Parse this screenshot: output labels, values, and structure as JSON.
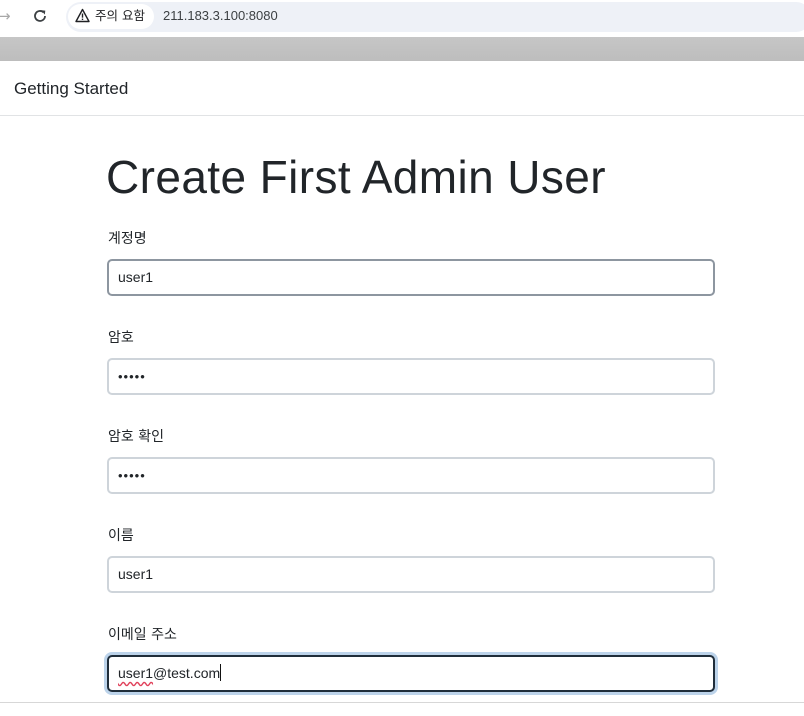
{
  "browser": {
    "forward_icon": "arrow-right-icon",
    "reload_icon": "reload-icon",
    "security_icon": "warning-triangle-icon",
    "security_label": "주의 요함",
    "url": "211.183.3.100:8080"
  },
  "panel": {
    "header_title": "Getting Started",
    "page_title": "Create First Admin User"
  },
  "form": {
    "username": {
      "label": "계정명",
      "value": "user1"
    },
    "password": {
      "label": "암호",
      "value": "•••••"
    },
    "password_confirm": {
      "label": "암호 확인",
      "value": "•••••"
    },
    "full_name": {
      "label": "이름",
      "value": "user1"
    },
    "email": {
      "label": "이메일 주소",
      "value_user": "user1",
      "value_domain": "@test.com"
    }
  },
  "colors": {
    "focus_border": "#1f2d3a",
    "focus_ring": "#bcd3ea",
    "input_border": "#ced4da",
    "text": "#212529"
  }
}
